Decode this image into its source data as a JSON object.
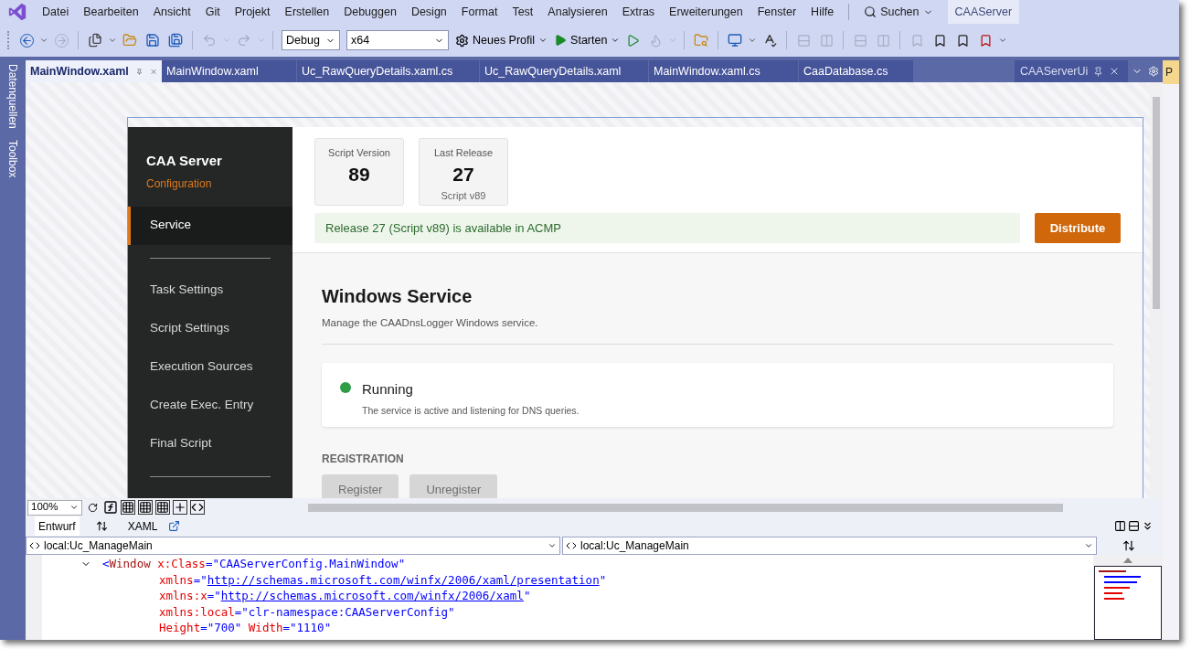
{
  "menu": [
    "Datei",
    "Bearbeiten",
    "Ansicht",
    "Git",
    "Projekt",
    "Erstellen",
    "Debuggen",
    "Design",
    "Format",
    "Test",
    "Analysieren",
    "Extras",
    "Erweiterungen",
    "Fenster",
    "Hilfe"
  ],
  "search": {
    "label": "Suchen"
  },
  "solution": "CAAServer",
  "toolbar": {
    "configuration": "Debug",
    "platform": "x64",
    "profile": "Neues Profil",
    "start": "Starten"
  },
  "side_tabs": [
    "Datenquellen",
    "Toolbox"
  ],
  "doc_tabs": [
    {
      "label": "MainWindow.xaml",
      "selected": true
    },
    {
      "label": "MainWindow.xaml",
      "selected": false
    },
    {
      "label": "Uc_RawQueryDetails.xaml.cs",
      "selected": false
    },
    {
      "label": "Uc_RawQueryDetails.xaml",
      "selected": false
    },
    {
      "label": "MainWindow.xaml.cs",
      "selected": false
    },
    {
      "label": "CaaDatabase.cs",
      "selected": false
    }
  ],
  "tool_window_tab": "CAAServerUi",
  "properties_tab": "P",
  "app": {
    "title": "CAA Server",
    "subtitle": "Configuration",
    "nav": [
      {
        "kind": "item",
        "label": "Service",
        "selected": true
      },
      {
        "kind": "divider"
      },
      {
        "kind": "item",
        "label": "Task Settings",
        "selected": false
      },
      {
        "kind": "item",
        "label": "Script Settings",
        "selected": false
      },
      {
        "kind": "item",
        "label": "Execution Sources",
        "selected": false
      },
      {
        "kind": "item",
        "label": "Create Exec. Entry",
        "selected": false
      },
      {
        "kind": "item",
        "label": "Final Script",
        "selected": false
      },
      {
        "kind": "divider"
      }
    ],
    "stats": [
      {
        "label": "Script Version",
        "value": "89"
      },
      {
        "label": "Last Release",
        "value": "27",
        "note": "Script v89"
      }
    ],
    "banner": "Release 27 (Script v89) is available in ACMP",
    "distribute": "Distribute",
    "section": {
      "title": "Windows Service",
      "description": "Manage the CAADnsLogger Windows service."
    },
    "status": {
      "label": "Running",
      "color": "#2e9d48",
      "description": "The service is active and listening for DNS queries."
    },
    "registration": {
      "heading": "REGISTRATION",
      "buttons": [
        {
          "label": "Register",
          "disabled": true
        },
        {
          "label": "Unregister",
          "disabled": true
        }
      ]
    }
  },
  "zoom": "100%",
  "view_tabs": [
    {
      "label": "Entwurf",
      "selected": true
    },
    {
      "label": "XAML",
      "selected": false
    }
  ],
  "scopes": [
    "local:Uc_ManageMain",
    "local:Uc_ManageMain"
  ],
  "code": [
    [
      {
        "kind": "punct",
        "text": "<"
      },
      {
        "kind": "tag",
        "text": "Window"
      },
      {
        "kind": "attr",
        "text": "x:Class",
        "gap": true
      },
      {
        "kind": "punct",
        "text": "=\""
      },
      {
        "kind": "value",
        "text": "CAAServerConfig.MainWindow"
      },
      {
        "kind": "punct",
        "text": "\""
      }
    ],
    [
      {
        "kind": "attr",
        "text": "xmlns"
      },
      {
        "kind": "punct",
        "text": "=\""
      },
      {
        "kind": "link",
        "text": "http://schemas.microsoft.com/winfx/2006/xaml/presentation"
      },
      {
        "kind": "punct",
        "text": "\""
      }
    ],
    [
      {
        "kind": "attr",
        "text": "xmlns:x"
      },
      {
        "kind": "punct",
        "text": "=\""
      },
      {
        "kind": "link",
        "text": "http://schemas.microsoft.com/winfx/2006/xaml"
      },
      {
        "kind": "punct",
        "text": "\""
      }
    ],
    [
      {
        "kind": "attr",
        "text": "xmlns:local"
      },
      {
        "kind": "punct",
        "text": "=\""
      },
      {
        "kind": "value",
        "text": "clr-namespace:CAAServerConfig"
      },
      {
        "kind": "punct",
        "text": "\""
      }
    ],
    [
      {
        "kind": "attr",
        "text": "Height"
      },
      {
        "kind": "punct",
        "text": "=\""
      },
      {
        "kind": "value",
        "text": "700"
      },
      {
        "kind": "punct",
        "text": "\""
      },
      {
        "kind": "attr",
        "text": "Width",
        "gap": true
      },
      {
        "kind": "punct",
        "text": "=\""
      },
      {
        "kind": "value",
        "text": "1110"
      },
      {
        "kind": "punct",
        "text": "\""
      }
    ]
  ]
}
